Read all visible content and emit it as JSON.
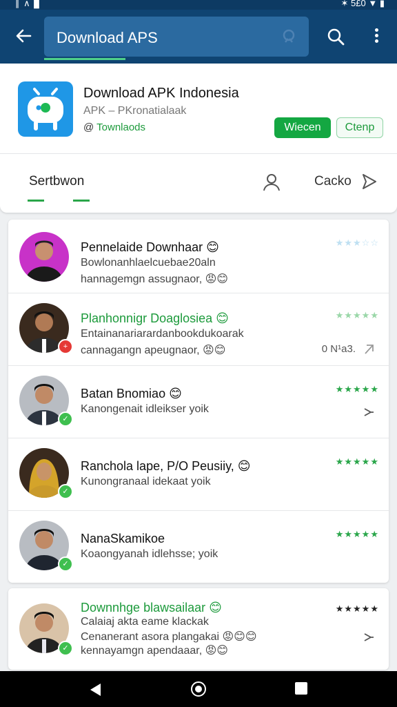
{
  "status_bar": {
    "left_text": "∥ ∧ ▊",
    "right_text": "✶ 5£0 ▼ ▮"
  },
  "app_bar": {
    "search_query": "Download APS"
  },
  "app": {
    "title": "Download APK Indonesia",
    "subtitle": "APK – PKronatialaak",
    "developer_prefix": "@",
    "developer": "Townlaods",
    "primary_button": "Wiecen",
    "secondary_button": "Ctenp"
  },
  "tabs": {
    "section_label": "Sertbwon",
    "right_label": "Cacko"
  },
  "reviews": [
    {
      "name": "Pennelaide Downhaar 😊",
      "line1": "Bowlonanhlaelcuebae20aln",
      "line2": "hannagemgn assugnaor, 😡😊",
      "stars": "★★★☆☆",
      "rating": 3,
      "badge": ""
    },
    {
      "name": "Planhonnigr Doaglosiea 😊",
      "line1": "Entainanariarardanbookdukoarak",
      "line2": "cannagangn apeugnaor, 😡😊",
      "stars": "★★★★★",
      "rating": 5,
      "meta": "0 N¹a3.",
      "badge": "+"
    },
    {
      "name": "Batan Bnomiao 😊",
      "line1": "Kanongenait idleikser yoik",
      "line2": "",
      "stars": "★★★★★",
      "rating": 5,
      "badge": "✓"
    },
    {
      "name": "Ranchola lape, P/O Peusiiy, 😊",
      "line1": "Kunongranaal idekaat yoik",
      "line2": "",
      "stars": "★★★★★",
      "rating": 5,
      "badge": "✓"
    },
    {
      "name": "NanaSkamikoe",
      "line1": "Koaongyanah idlehsse; yoik",
      "line2": "",
      "stars": "★★★★★",
      "rating": 5,
      "badge": "✓"
    },
    {
      "name": "Downnhge blawsailaar 😊",
      "line1": "Calaiaj akta eame klackak",
      "line2": "Cenanerant asora plangakai 😡😊😊",
      "line3": "kennayamgn apendaaar, 😡😊",
      "stars": "★★★★★",
      "rating": 5,
      "badge": "✓"
    }
  ],
  "colors": {
    "appbar": "#0f4472",
    "accent_green": "#14a742",
    "app_icon": "#1f97e6"
  }
}
